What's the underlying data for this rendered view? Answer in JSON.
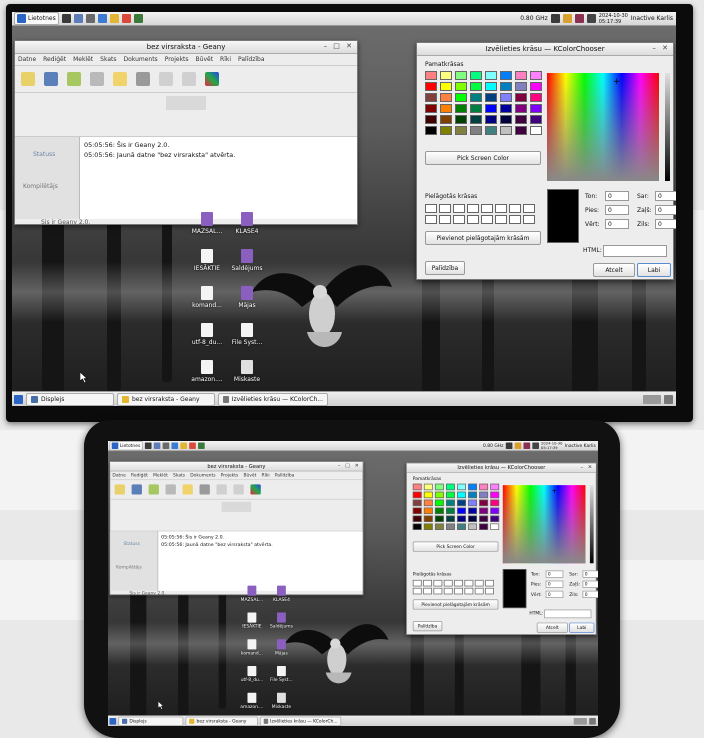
{
  "topbar": {
    "menu_label": "Lietotnes",
    "cpu_freq": "0.80 GHz",
    "date": "2024-10-30",
    "time": "05:17:39",
    "user_label": "Inactive Karlis"
  },
  "geany": {
    "title": "bez virsraksta - Geany",
    "menu": [
      "Datne",
      "Rediģēt",
      "Meklēt",
      "Skats",
      "Dokuments",
      "Projekts",
      "Būvēt",
      "Rīki",
      "Palīdzība"
    ],
    "sidebar_tabs": [
      "Statuss",
      "Kompilētājs"
    ],
    "log": [
      {
        "time": "05:05:56:",
        "text": "Šis ir Geany 2.0."
      },
      {
        "time": "05:05:56:",
        "text": "Jaunā datne \"bez virsraksta\" atvērta."
      }
    ],
    "statusbar": "Šis ir Geany 2.0."
  },
  "kcolor": {
    "title": "Izvēlieties krāsu — KColorChooser",
    "basic_colors_label": "Pamatkrāsas",
    "pick_screen_label": "Pick Screen Color",
    "custom_colors_label": "Pielāgotās krāsas",
    "add_custom_label": "Pievienot pielāgotajām krāsām",
    "html_label": "HTML:",
    "help_label": "Palīdzība",
    "cancel_label": "Atcelt",
    "ok_label": "Labi",
    "fields": [
      {
        "label": "Ton:",
        "value": "0"
      },
      {
        "label": "Pies:",
        "value": "0"
      },
      {
        "label": "Vērt:",
        "value": "0"
      },
      {
        "label": "Sar:",
        "value": "0"
      },
      {
        "label": "Zaļš:",
        "value": "0"
      },
      {
        "label": "Zils:",
        "value": "0"
      }
    ],
    "basic_colors": [
      "#ff8080",
      "#ffff80",
      "#80ff80",
      "#00ff80",
      "#80ffff",
      "#0080ff",
      "#ff80c0",
      "#ff80ff",
      "#ff0000",
      "#ffff00",
      "#80ff00",
      "#00ff40",
      "#00ffff",
      "#0080c0",
      "#8080c0",
      "#ff00ff",
      "#804040",
      "#ff8040",
      "#00ff00",
      "#008080",
      "#004080",
      "#8080ff",
      "#800040",
      "#ff0080",
      "#800000",
      "#ff8000",
      "#008000",
      "#008040",
      "#0000ff",
      "#0000a0",
      "#800080",
      "#8000ff",
      "#400000",
      "#804000",
      "#004000",
      "#004040",
      "#000080",
      "#000040",
      "#400040",
      "#400080",
      "#000000",
      "#808000",
      "#808040",
      "#808080",
      "#408080",
      "#c0c0c0",
      "#400040",
      "#ffffff"
    ]
  },
  "desktop_icons": [
    {
      "label": "MAZSAL...",
      "color": "#8b5fbf"
    },
    {
      "label": "KLASE4",
      "color": "#8b5fbf"
    },
    {
      "label": "IESĀKTIE",
      "color": "#f4f4f4"
    },
    {
      "label": "Saldējums",
      "color": "#8b5fbf"
    },
    {
      "label": "komand...",
      "color": "#f4f4f4"
    },
    {
      "label": "Mājas",
      "color": "#8b5fbf"
    },
    {
      "label": "utf-8_du...",
      "color": "#f4f4f4"
    },
    {
      "label": "File Syst...",
      "color": "#f4f4f4"
    },
    {
      "label": "amazon....",
      "color": "#f4f4f4"
    },
    {
      "label": "Miskaste",
      "color": "#e0e0e0"
    }
  ],
  "taskbar": {
    "items": [
      "Displejs",
      "bez virsraksta - Geany",
      "Izvēlieties krāsu — KColorCh..."
    ]
  }
}
